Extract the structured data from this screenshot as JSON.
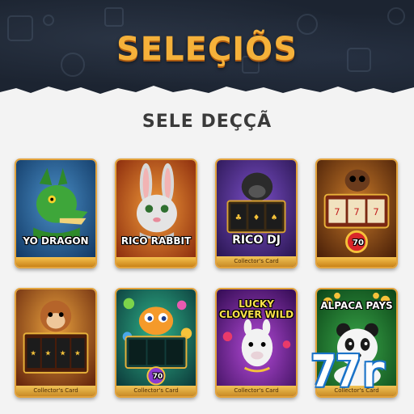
{
  "header": {
    "title": "SELEÇIÕS"
  },
  "section": {
    "title": "SELE DEÇÇÃ"
  },
  "games": [
    {
      "name": "YO DRAGON",
      "subtitle": "",
      "icon": "green-dragon"
    },
    {
      "name": "RICO RABBIT",
      "subtitle": "",
      "icon": "rabbit"
    },
    {
      "name": "RICO DJ",
      "subtitle": "Collector's Card",
      "icon": "gorilla-slot"
    },
    {
      "name": "",
      "subtitle": "",
      "icon": "bear-slot-machine",
      "badge": "70"
    },
    {
      "name": "",
      "subtitle": "Collector's Card",
      "icon": "monkey-slot"
    },
    {
      "name": "",
      "subtitle": "Collector's Card",
      "icon": "fish-slot",
      "badge": "70"
    },
    {
      "name": "LUCKY CLOVER WILD",
      "subtitle": "Collector's Card",
      "icon": "llama"
    },
    {
      "name": "ALPACA PAYS",
      "subtitle": "Collector's Card",
      "icon": "panda"
    }
  ],
  "watermark": {
    "text": "77r"
  },
  "colors": {
    "header_bg": "#1c2431",
    "title_gold": "#f5b13a",
    "card_border": "#e3a33c",
    "page_bg": "#f3f3f3"
  }
}
